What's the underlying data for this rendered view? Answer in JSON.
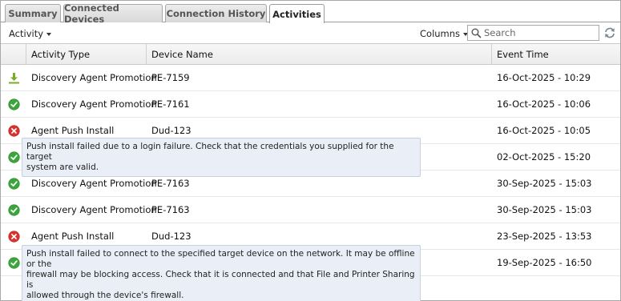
{
  "tabs": [
    {
      "label": "Summary"
    },
    {
      "label": "Connected Devices"
    },
    {
      "label": "Connection History"
    },
    {
      "label": "Activities"
    }
  ],
  "toolbar": {
    "activity_label": "Activity",
    "columns_label": "Columns",
    "search_placeholder": "Search"
  },
  "grid": {
    "columns": [
      "Activity Type",
      "Device Name",
      "Event Time"
    ],
    "rows": [
      {
        "status_icon": "download-icon",
        "activity": "Discovery Agent Promotion",
        "device": "PE-7159",
        "time": "16-Oct-2025 - 10:29"
      },
      {
        "status_icon": "success-icon",
        "activity": "Discovery Agent Promotion",
        "device": "PE-7161",
        "time": "16-Oct-2025 - 10:06"
      },
      {
        "status_icon": "error-icon",
        "activity": "Agent Push Install",
        "device": "Dud-123",
        "time": "16-Oct-2025 - 10:05"
      },
      {
        "status_icon": "success-icon",
        "activity": "",
        "device": "",
        "time": "02-Oct-2025 - 15:20"
      },
      {
        "status_icon": "success-icon",
        "activity": "Discovery Agent Promotion",
        "device": "PE-7163",
        "time": "30-Sep-2025 - 15:03"
      },
      {
        "status_icon": "success-icon",
        "activity": "Discovery Agent Promotion",
        "device": "PE-7163",
        "time": "30-Sep-2025 - 15:03"
      },
      {
        "status_icon": "error-icon",
        "activity": "Agent Push Install",
        "device": "Dud-123",
        "time": "23-Sep-2025 - 13:53"
      },
      {
        "status_icon": "success-icon",
        "activity": "",
        "device": "",
        "time": "19-Sep-2025 - 16:50"
      }
    ]
  },
  "tooltips": [
    {
      "line1": "Push install failed due to a login failure. Check that the credentials you supplied for the target",
      "line2": "system are valid."
    },
    {
      "line1": "Push install failed to connect to the specified target device on the network. It may be offline or the",
      "line2": "firewall may be blocking access. Check that it is connected and that File and Printer Sharing is",
      "line3": "allowed through the device's firewall."
    }
  ],
  "colors": {
    "success": "#3aa53a",
    "error": "#d9322f",
    "download": "#7aaa2a",
    "tooltip_bg": "#e9eef7"
  }
}
